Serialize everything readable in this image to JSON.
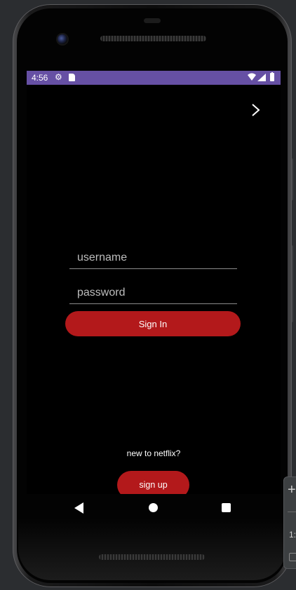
{
  "status_bar": {
    "time": "4:56",
    "icons": [
      "gear-icon",
      "sd-card-icon",
      "wifi-icon",
      "signal-icon",
      "battery-icon"
    ],
    "background_color": "#6650a4"
  },
  "top_action": {
    "icon": "chevron-right-icon"
  },
  "login_form": {
    "username_placeholder": "username",
    "password_placeholder": "password",
    "signin_label": "Sign In"
  },
  "signup_section": {
    "prompt": "new to netflix?",
    "signup_label": "sign up"
  },
  "nav_bar": {
    "icons": [
      "back-icon",
      "home-icon",
      "recents-icon"
    ]
  },
  "emulator_toolbar": {
    "zoom_in_symbol": "+",
    "zoom_text": "1:"
  },
  "colors": {
    "accent": "#b3191b",
    "screen_background": "#000000",
    "frame_background": "#2b2d30"
  }
}
